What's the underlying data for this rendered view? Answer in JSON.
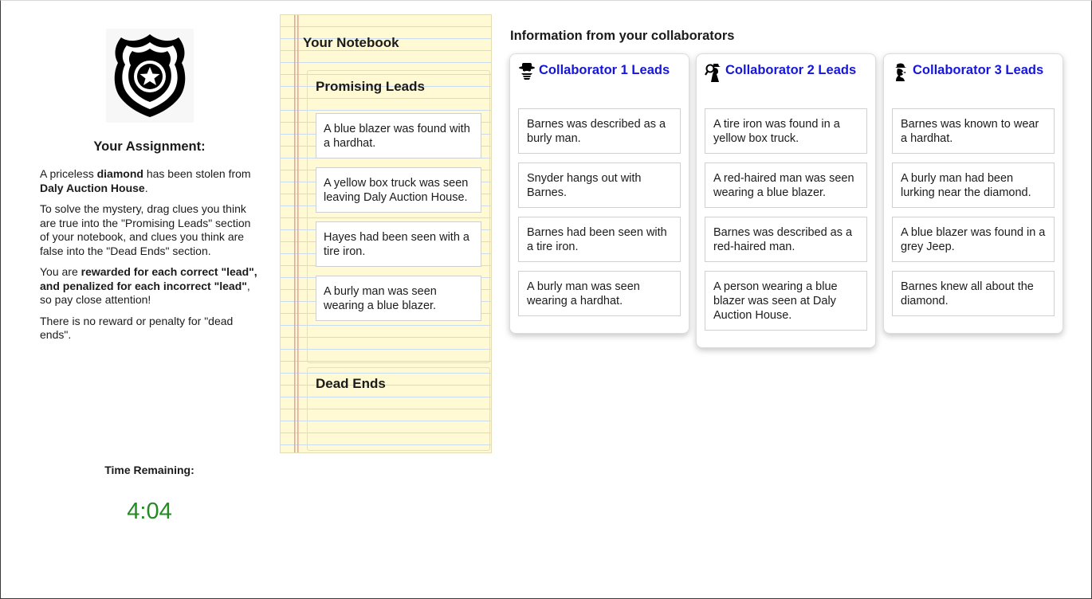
{
  "assignment": {
    "badge_icon": "police-badge-icon",
    "title": "Your Assignment:",
    "p1_a": "A priceless ",
    "p1_b": "diamond",
    "p1_c": " has been stolen from ",
    "p1_d": "Daly Auction House",
    "p1_e": ".",
    "p2": "To solve the mystery, drag clues you think are true into the \"Promising Leads\" section of your notebook, and clues you think are false into the \"Dead Ends\" section.",
    "p3_a": "You are ",
    "p3_b": "rewarded for each correct \"lead\", and penalized for each incorrect \"lead\"",
    "p3_c": ", so pay close attention!",
    "p4": "There is no reward or penalty for \"dead ends\"."
  },
  "timer": {
    "label": "Time Remaining:",
    "value": "4:04",
    "color": "#228b22"
  },
  "notebook": {
    "title": "Your Notebook",
    "leads_title": "Promising Leads",
    "leads": [
      "A blue blazer was found with a hardhat.",
      "A yellow box truck was seen leaving Daly Auction House.",
      "Hayes had been seen with a tire iron.",
      "A burly man was seen wearing a blue blazer."
    ],
    "dead_title": "Dead Ends",
    "dead": []
  },
  "collaborators": {
    "heading": "Information from your collaborators",
    "link_color": "#1515e0",
    "columns": [
      {
        "icon": "spy-hat-icon",
        "name": "Collaborator 1 Leads",
        "cards": [
          "Barnes was described as a burly man.",
          "Snyder hangs out with Barnes.",
          "Barnes had been seen with a tire iron.",
          "A burly man was seen wearing a hardhat."
        ]
      },
      {
        "icon": "detective-magnifier-icon",
        "name": "Collaborator 2 Leads",
        "cards": [
          "A tire iron was found in a yellow box truck.",
          "A red-haired man was seen wearing a blue blazer.",
          "Barnes was described as a red-haired man.",
          "A person wearing a blue blazer was seen at Daly Auction House."
        ]
      },
      {
        "icon": "detective-silhouette-icon",
        "name": "Collaborator 3 Leads",
        "cards": [
          "Barnes was known to wear a hardhat.",
          "A burly man had been lurking near the diamond.",
          "A blue blazer was found in a grey Jeep.",
          "Barnes knew all about the diamond."
        ]
      }
    ]
  }
}
